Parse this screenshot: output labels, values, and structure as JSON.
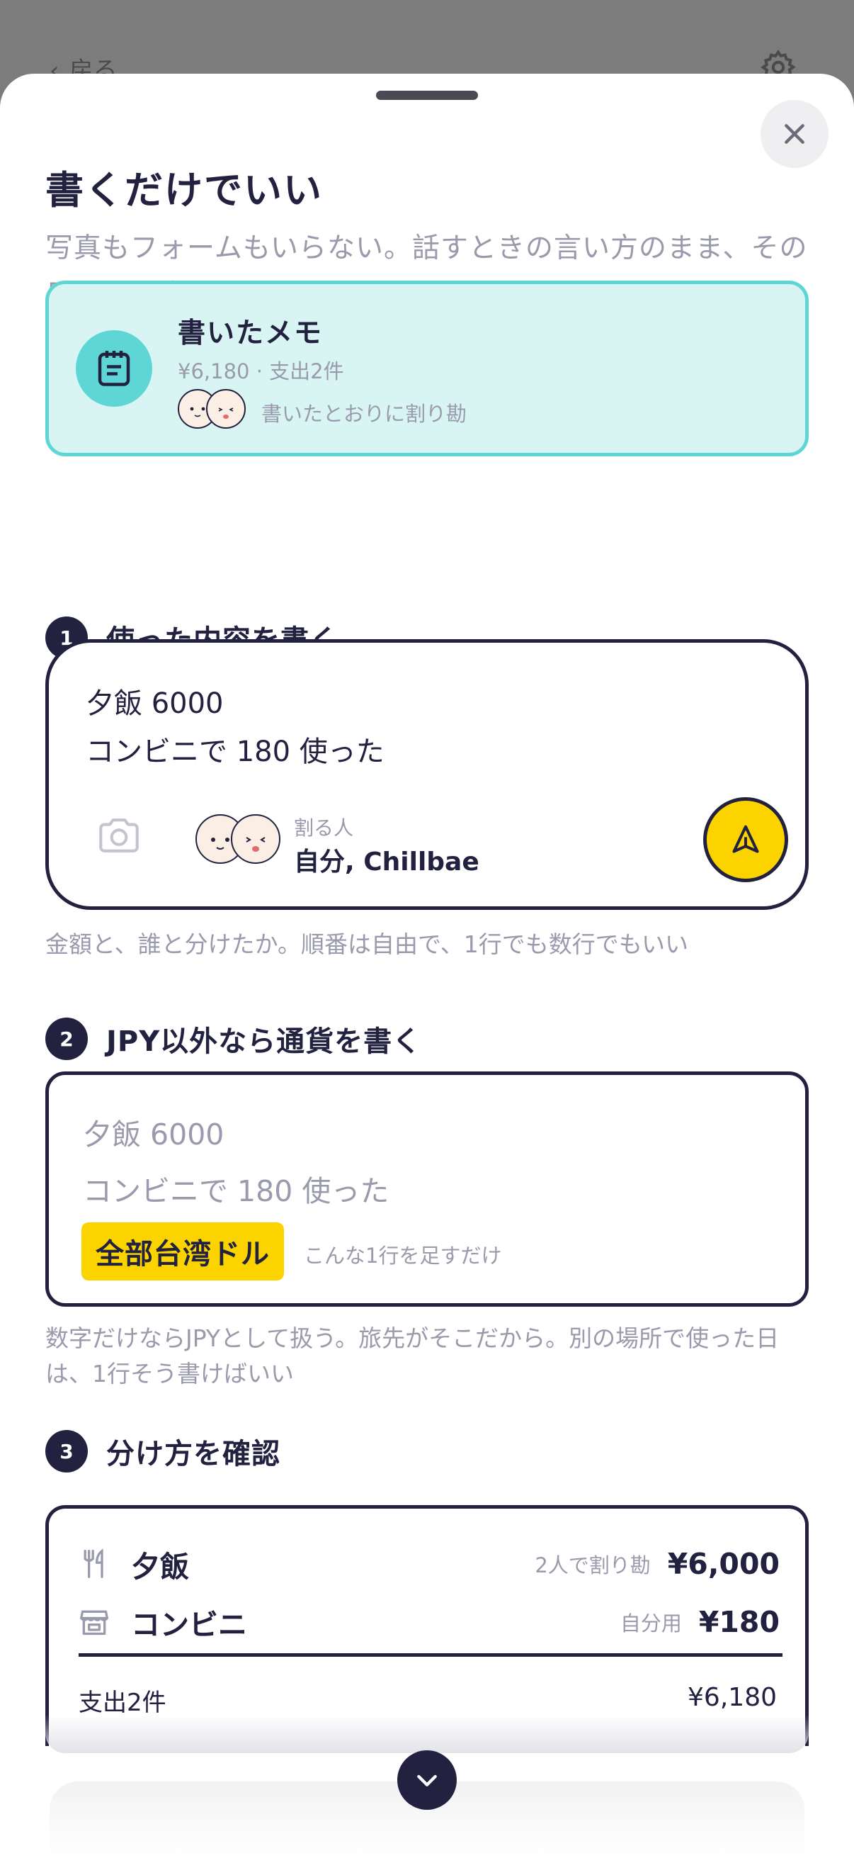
{
  "background": {
    "back_label": "戻る"
  },
  "sheet": {
    "title": "書くだけでいい",
    "subtitle": "写真もフォームもいらない。話すときの言い方のまま、その日の分を書けばいい"
  },
  "memo": {
    "title": "書いたメモ",
    "summary": "¥6,180 · 支出2件",
    "split_text": "書いたとおりに割り勘"
  },
  "steps": [
    {
      "number": "1",
      "label": "使った内容を書く"
    },
    {
      "number": "2",
      "label": "JPY以外なら通貨を書く"
    },
    {
      "number": "3",
      "label": "分け方を確認"
    }
  ],
  "input": {
    "line1": "夕飯 6000",
    "line2": "コンビニで 180 使った",
    "split_caption": "割る人",
    "split_names": "自分, Chillbae"
  },
  "hints": {
    "step1": "金額と、誰と分けたか。順番は自由で、1行でも数行でもいい",
    "step2": "数字だけならJPYとして扱う。旅先がそこだから。別の場所で使った日は、1行そう書けばいい"
  },
  "currency_example": {
    "line1": "夕飯 6000",
    "line2": "コンビニで 180 使った",
    "tag": "全部台湾ドル",
    "note": "こんな1行を足すだけ"
  },
  "summary": {
    "rows": [
      {
        "name": "夕飯",
        "note": "2人で割り勘",
        "amount": "¥6,000"
      },
      {
        "name": "コンビニ",
        "note": "自分用",
        "amount": "¥180"
      }
    ],
    "total_label": "支出2件",
    "total_amount": "¥6,180"
  },
  "colors": {
    "navy": "#232140",
    "teal": "#5fd6d6",
    "teal_light": "#d8f5f4",
    "yellow": "#fbd400",
    "muted": "#9a9aad"
  }
}
